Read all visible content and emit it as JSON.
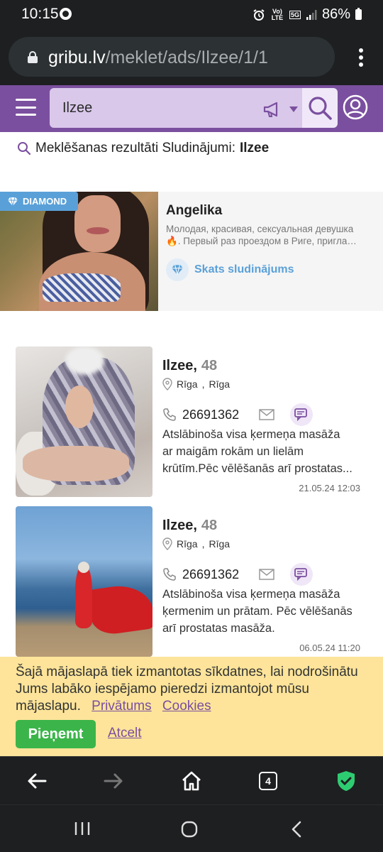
{
  "status_bar": {
    "time": "10:15",
    "battery": "86%",
    "volte": "Vo) LTE",
    "network": "5G"
  },
  "browser": {
    "url_host": "gribu.lv",
    "url_path": "/meklet/ads/Ilzee/1/1",
    "tab_count": "4"
  },
  "header": {
    "search_value": "Ilzee"
  },
  "results": {
    "prefix": "Meklēšanas rezultāti Sludinājumi:",
    "query": "Ilzee"
  },
  "diamond_ad": {
    "badge": "DIAMOND",
    "name": "Angelika",
    "desc_line1": "Молодая, красивая, сексуальная девушка",
    "desc_line2": "🔥. Первый раз проездом в Риге, пригла…",
    "link_label": "Skats sludinājums"
  },
  "listings": [
    {
      "name": "Ilzee,",
      "age": "48",
      "city": "Rīga",
      "district": "Rīga",
      "phone": "26691362",
      "text1": "Atslābinoša visa ķermeņa masāža",
      "text2": "ar maigām rokām un lielām",
      "text3": "krūtīm.Pēc vēlēšanās arī prostatas...",
      "date": "21.05.24 12:03"
    },
    {
      "name": "Ilzee,",
      "age": "48",
      "city": "Rīga",
      "district": "Rīga",
      "phone": "26691362",
      "text1": "Atslābinoša visa ķermeņa masāža",
      "text2": "ķermenim un prātam. Pēc vēlēšanās",
      "text3": "arī prostatas masāža.",
      "date": "06.05.24 11:20"
    }
  ],
  "cookie": {
    "text": "Šajā mājaslapā tiek izmantotas sīkdatnes, lai nodrošinātu Jums labāko iespējamo pieredzi izmantojot mūsu mājaslapu.",
    "privacy_link": "Privātums",
    "cookies_link": "Cookies",
    "accept_label": "Pieņemt",
    "cancel_label": "Atcelt"
  },
  "colors": {
    "brand_purple": "#7b4f9f",
    "diamond_blue": "#5aa0d8",
    "cookie_bg": "#fde49a",
    "accept_green": "#3bb54a",
    "shield_green": "#2ecc71"
  }
}
